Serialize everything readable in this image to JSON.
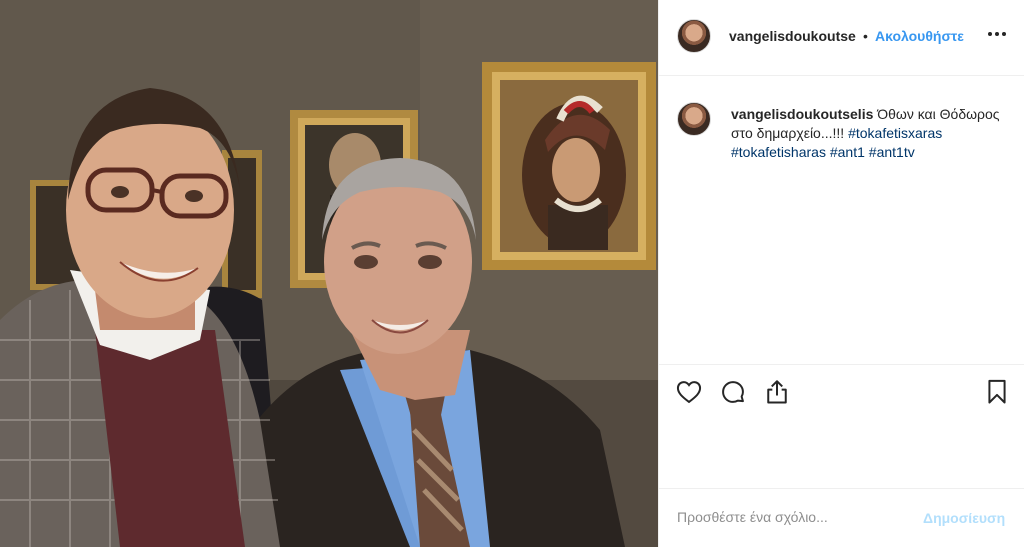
{
  "post": {
    "author": {
      "username": "vangelisdoukoutse",
      "avatar": "profile-photo"
    },
    "follow_separator": "•",
    "follow_label": "Ακολουθήστε",
    "more_icon": "three-dots-icon",
    "caption": {
      "username": "vangelisdoukoutselis",
      "text": "Όθων και Θόδωρος στο δημαρχείο...!!!",
      "hashtags": [
        "#tokafetisxaras",
        "#tokafetisharas",
        "#ant1",
        "#ant1tv"
      ]
    },
    "actions": {
      "like_icon": "heart-icon",
      "comment_icon": "comment-bubble-icon",
      "share_icon": "share-upload-icon",
      "save_icon": "bookmark-icon"
    },
    "comment": {
      "placeholder": "Προσθέστε ένα σχόλιο...",
      "publish_label": "Δημοσίευση"
    }
  },
  "colors": {
    "link_blue": "#3897f0",
    "hashtag_blue": "#003569",
    "publish_disabled": "#b2dffc",
    "text_dark": "#262626",
    "placeholder_gray": "#8e8e8e"
  }
}
